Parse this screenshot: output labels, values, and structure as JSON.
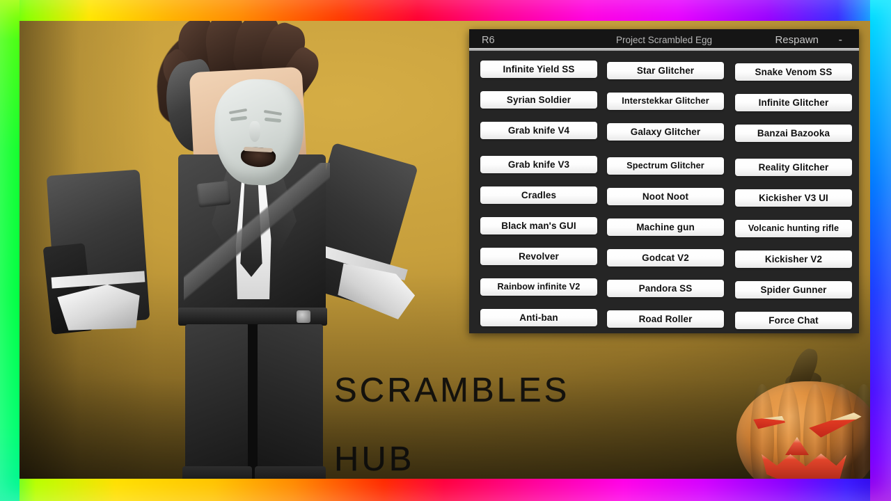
{
  "overlay": {
    "title_line1": "Scrambles",
    "title_line2": "Hub"
  },
  "gui": {
    "titlebar": {
      "rig": "R6",
      "project": "Project Scrambled Egg",
      "respawn": "Respawn",
      "minimize": "-"
    },
    "columns": [
      {
        "name": "column-1",
        "buttons": [
          "Infinite Yield SS",
          "Syrian Soldier",
          "Grab knife V4",
          "Grab knife V3",
          "Cradles",
          "Black man's GUI",
          "Revolver",
          "Rainbow infinite V2",
          "Anti-ban"
        ]
      },
      {
        "name": "column-2",
        "buttons": [
          "Star Glitcher",
          "Interstekkar Glitcher",
          "Galaxy Glitcher",
          "Spectrum Glitcher",
          "Noot Noot",
          "Machine gun",
          "Godcat V2",
          "Pandora SS",
          "Road Roller"
        ]
      },
      {
        "name": "column-3",
        "buttons": [
          "Snake Venom SS",
          "Infinite Glitcher",
          "Banzai Bazooka",
          "Reality Glitcher",
          "Kickisher V3 UI",
          "Volcanic hunting rifle",
          "Kickisher V2",
          "Spider Gunner",
          "Force Chat"
        ]
      }
    ]
  },
  "colors": {
    "panel_bg": "#252525",
    "titlebar_bg": "#151515",
    "button_face": "#ffffff",
    "button_text": "#101010",
    "backdrop_gold": "#c79f3c",
    "pumpkin_orange": "#e1913f",
    "pumpkin_glow_red": "#e03a22"
  }
}
